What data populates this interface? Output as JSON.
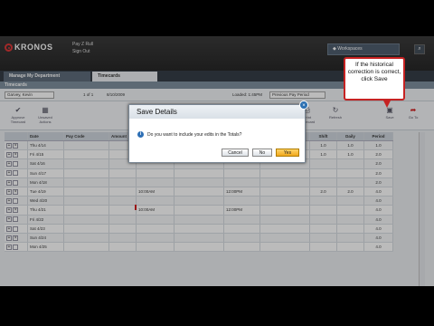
{
  "header": {
    "brand": "KRONOS",
    "pay_link": "Pay Z Rull",
    "signout_link": "Sign Out",
    "workspace_label": "Workspaces",
    "search_icon": "search-icon"
  },
  "tabs": [
    {
      "label": "Manage My Department"
    },
    {
      "label": "Timecards"
    }
  ],
  "subheader": "Timecards",
  "toprow": {
    "employee": "Garvey, Kevin",
    "pager": "1 of 1",
    "date": "8/10/2009",
    "loaded": "Loaded: 1:45PM",
    "period": "Previous Pay Period"
  },
  "toolbar": [
    {
      "label": "Approve\nTimecard",
      "icon": "check-icon"
    },
    {
      "label": "Unsaved\nActions",
      "icon": "sheet-icon"
    },
    {
      "label": "Print\nTimecard",
      "icon": "print-icon"
    },
    {
      "label": "Refresh",
      "icon": "refresh-icon"
    },
    {
      "label": "Save",
      "icon": "save-icon"
    },
    {
      "label": "Go To",
      "icon": "goto-icon"
    }
  ],
  "grid": {
    "columns": [
      "Date",
      "Pay Code",
      "Amount",
      "In",
      "Transfer",
      "Out",
      "Transfer",
      "Shift",
      "Daily",
      "Period"
    ],
    "rows": [
      {
        "date": "Thu 4/14",
        "in": "",
        "out": "",
        "shift": "1.0",
        "daily": "1.0",
        "period": "1.0"
      },
      {
        "date": "Fri 4/15",
        "in": "",
        "out": "",
        "shift": "1.0",
        "daily": "1.0",
        "period": "2.0"
      },
      {
        "date": "Sat 4/16",
        "in": "",
        "out": "",
        "shift": "",
        "daily": "",
        "period": "2.0"
      },
      {
        "date": "Sun 4/17",
        "in": "",
        "out": "",
        "shift": "",
        "daily": "",
        "period": "2.0"
      },
      {
        "date": "Mon 4/18",
        "in": "",
        "out": "",
        "shift": "",
        "daily": "",
        "period": "2.0"
      },
      {
        "date": "Tue 4/19",
        "in": "10:00AM",
        "out": "12:00PM",
        "shift": "2.0",
        "daily": "2.0",
        "period": "4.0"
      },
      {
        "date": "Wed 4/20",
        "in": "",
        "out": "",
        "shift": "",
        "daily": "",
        "period": "4.0"
      },
      {
        "date": "Thu 4/21",
        "in": "10:00AM",
        "out": "12:00PM",
        "shift": "",
        "daily": "",
        "period": "4.0"
      },
      {
        "date": "Fri 4/22",
        "in": "",
        "out": "",
        "shift": "",
        "daily": "",
        "period": "4.0"
      },
      {
        "date": "Sat 4/23",
        "in": "",
        "out": "",
        "shift": "",
        "daily": "",
        "period": "4.0"
      },
      {
        "date": "Sun 4/24",
        "in": "",
        "out": "",
        "shift": "",
        "daily": "",
        "period": "4.0"
      },
      {
        "date": "Mon 4/25",
        "in": "",
        "out": "",
        "shift": "",
        "daily": "",
        "period": "4.0"
      }
    ]
  },
  "dialog": {
    "title": "Save Details",
    "message": "Do you want to include your edits in the Totals?",
    "cancel": "Cancel",
    "no": "No",
    "yes": "Yes"
  },
  "callout": "If the historical correction is correct, click Save"
}
